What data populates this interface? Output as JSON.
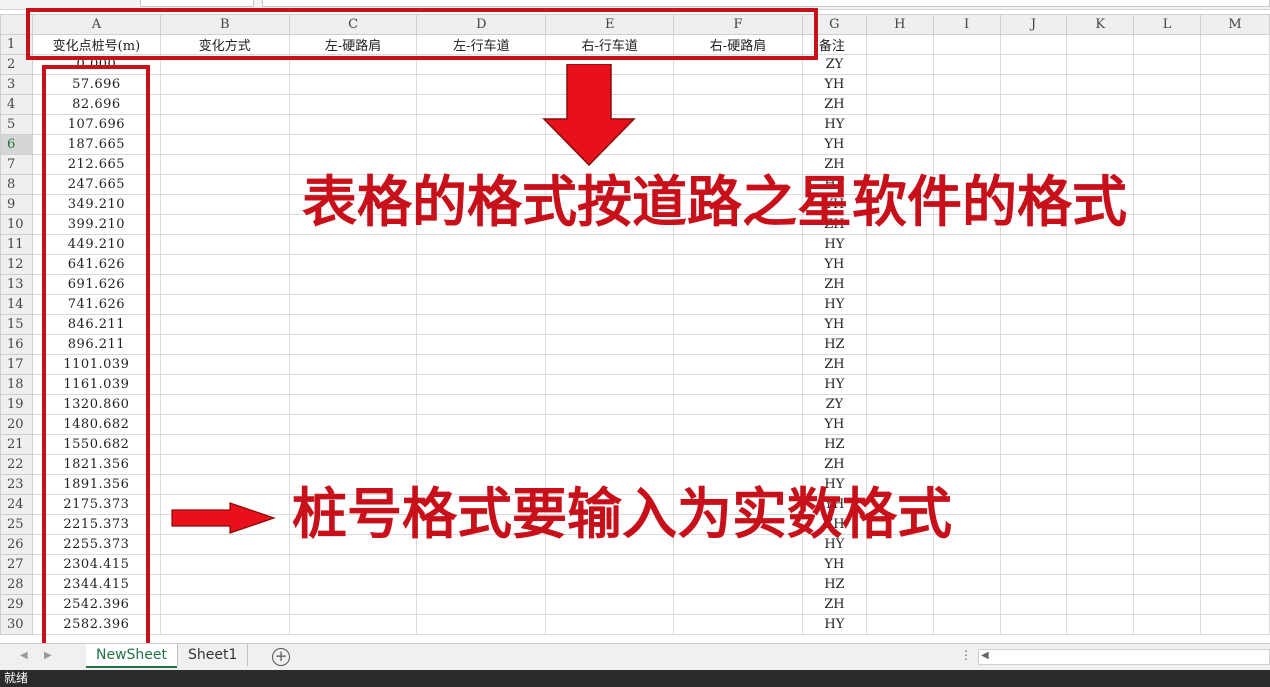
{
  "columns": [
    "A",
    "B",
    "C",
    "D",
    "E",
    "F",
    "G",
    "H",
    "I",
    "J",
    "K",
    "L",
    "M"
  ],
  "header_row": [
    "变化点桩号(m)",
    "变化方式",
    "左-硬路肩",
    "左-行车道",
    "右-行车道",
    "右-硬路肩",
    "备注"
  ],
  "rows": [
    {
      "n": "2",
      "a": "0.000",
      "g": "ZY"
    },
    {
      "n": "3",
      "a": "57.696",
      "g": "YH"
    },
    {
      "n": "4",
      "a": "82.696",
      "g": "ZH"
    },
    {
      "n": "5",
      "a": "107.696",
      "g": "HY"
    },
    {
      "n": "6",
      "a": "187.665",
      "g": "YH"
    },
    {
      "n": "7",
      "a": "212.665",
      "g": "ZH"
    },
    {
      "n": "8",
      "a": "247.665",
      "g": "HY"
    },
    {
      "n": "9",
      "a": "349.210",
      "g": "YH"
    },
    {
      "n": "10",
      "a": "399.210",
      "g": "ZH"
    },
    {
      "n": "11",
      "a": "449.210",
      "g": "HY"
    },
    {
      "n": "12",
      "a": "641.626",
      "g": "YH"
    },
    {
      "n": "13",
      "a": "691.626",
      "g": "ZH"
    },
    {
      "n": "14",
      "a": "741.626",
      "g": "HY"
    },
    {
      "n": "15",
      "a": "846.211",
      "g": "YH"
    },
    {
      "n": "16",
      "a": "896.211",
      "g": "HZ"
    },
    {
      "n": "17",
      "a": "1101.039",
      "g": "ZH"
    },
    {
      "n": "18",
      "a": "1161.039",
      "g": "HY"
    },
    {
      "n": "19",
      "a": "1320.860",
      "g": "ZY"
    },
    {
      "n": "20",
      "a": "1480.682",
      "g": "YH"
    },
    {
      "n": "21",
      "a": "1550.682",
      "g": "HZ"
    },
    {
      "n": "22",
      "a": "1821.356",
      "g": "ZH"
    },
    {
      "n": "23",
      "a": "1891.356",
      "g": "HY"
    },
    {
      "n": "24",
      "a": "2175.373",
      "g": "YH"
    },
    {
      "n": "25",
      "a": "2215.373",
      "g": "ZH"
    },
    {
      "n": "26",
      "a": "2255.373",
      "g": "HY"
    },
    {
      "n": "27",
      "a": "2304.415",
      "g": "YH"
    },
    {
      "n": "28",
      "a": "2344.415",
      "g": "HZ"
    },
    {
      "n": "29",
      "a": "2542.396",
      "g": "ZH"
    },
    {
      "n": "30",
      "a": "2582.396",
      "g": "HY"
    }
  ],
  "active_row": "6",
  "annotations": {
    "top_text": "表格的格式按道路之星软件的格式",
    "bottom_text": "桩号格式要输入为实数格式",
    "color": "#c8101a"
  },
  "sheet_tabs": [
    "NewSheet",
    "Sheet1"
  ],
  "active_tab": "NewSheet",
  "add_sheet_icon": "plus-circle-icon",
  "status_text": "就绪"
}
